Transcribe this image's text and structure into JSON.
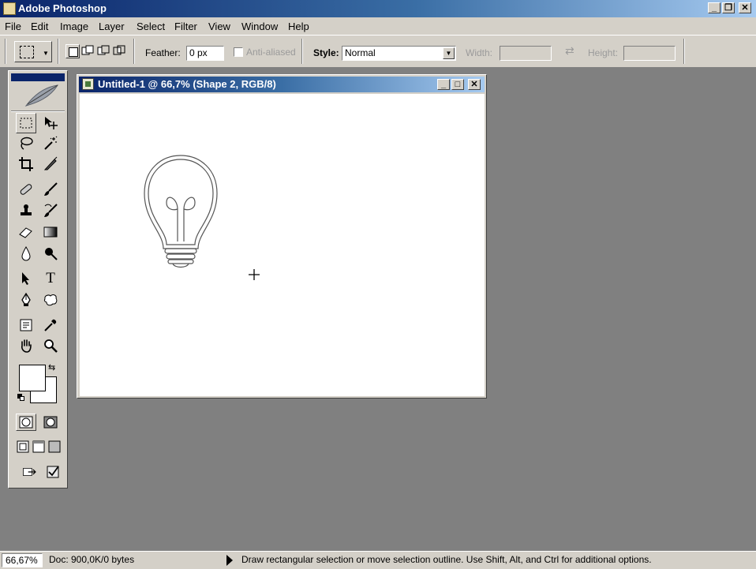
{
  "app": {
    "title": "Adobe Photoshop",
    "window_controls": [
      "_",
      "▫",
      "✕"
    ]
  },
  "menu": [
    "File",
    "Edit",
    "Image",
    "Layer",
    "Select",
    "Filter",
    "View",
    "Window",
    "Help"
  ],
  "options_bar": {
    "feather_label": "Feather:",
    "feather_value": "0 px",
    "anti_aliased_label": "Anti-aliased",
    "anti_aliased_checked": false,
    "style_label": "Style:",
    "style_value": "Normal",
    "width_label": "Width:",
    "width_value": "",
    "height_label": "Height:",
    "height_value": ""
  },
  "document": {
    "title": "Untitled-1 @ 66,7% (Shape 2, RGB/8)"
  },
  "tools": [
    "rectangular-marquee-tool",
    "move-tool",
    "lasso-tool",
    "magic-wand-tool",
    "crop-tool",
    "slice-tool",
    "healing-brush-tool",
    "brush-tool",
    "clone-stamp-tool",
    "history-brush-tool",
    "eraser-tool",
    "gradient-tool",
    "blur-tool",
    "dodge-tool",
    "path-selection-tool",
    "type-tool",
    "pen-tool",
    "custom-shape-tool",
    "notes-tool",
    "eyedropper-tool",
    "hand-tool",
    "zoom-tool"
  ],
  "colors": {
    "foreground": "#ffffff",
    "background": "#ffffff",
    "title_bar": "#0a246a",
    "workspace": "#808080",
    "chrome": "#d4d0c8"
  },
  "status": {
    "zoom": "66,67%",
    "doc_info": "Doc: 900,0K/0 bytes",
    "hint": "Draw rectangular selection or move selection outline.  Use Shift, Alt, and Ctrl for additional options."
  }
}
